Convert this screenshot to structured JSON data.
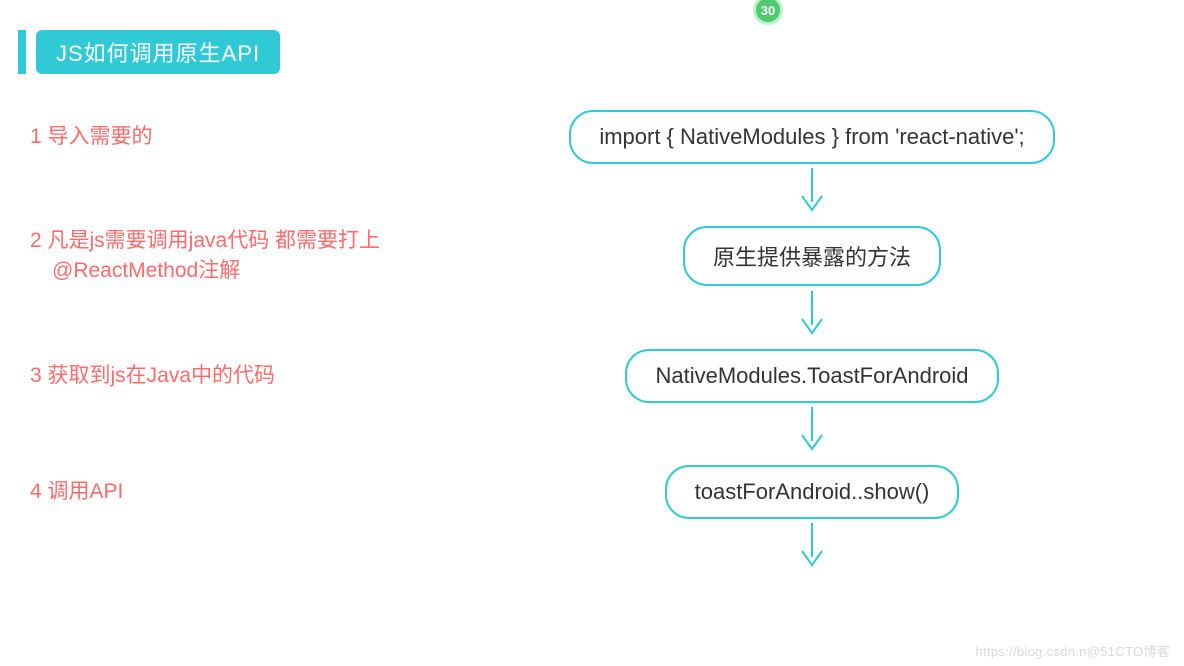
{
  "title": "JS如何调用原生API",
  "badge": "30",
  "steps": [
    {
      "label_line1": "1  导入需要的",
      "label_line2": "",
      "flow": "import { NativeModules } from 'react-native';"
    },
    {
      "label_line1": "2 凡是js需要调用java代码 都需要打上",
      "label_line2": "@ReactMethod注解",
      "flow": "原生提供暴露的方法"
    },
    {
      "label_line1": "3  获取到js在Java中的代码",
      "label_line2": "",
      "flow": "NativeModules.ToastForAndroid"
    },
    {
      "label_line1": "4  调用API",
      "label_line2": "",
      "flow": "toastForAndroid..show()"
    }
  ],
  "watermark": "https://blog.csdn.n@51CTO博客",
  "colors": {
    "accent": "#30c9d6",
    "step_text": "#ff6b6b",
    "badge": "#4ec96f"
  }
}
